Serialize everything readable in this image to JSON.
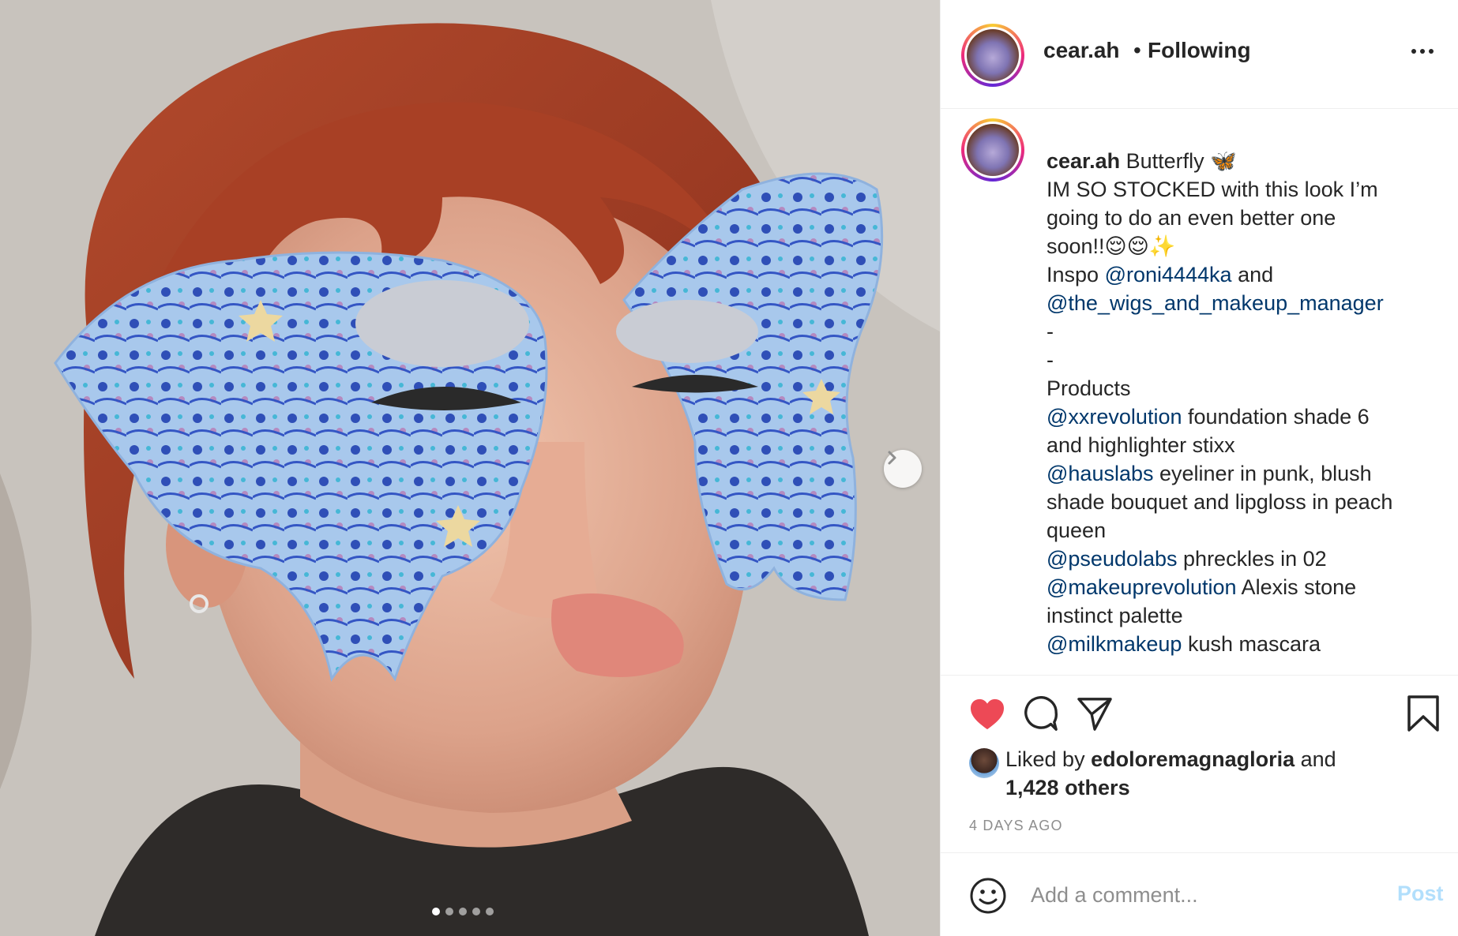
{
  "post": {
    "username": "cear.ah",
    "separator": "•",
    "follow_status": "Following",
    "photo_carousel": {
      "total_slides": 5,
      "active_slide": 1
    }
  },
  "caption": {
    "username": "cear.ah",
    "lines": [
      [
        {
          "t": "user",
          "v": "cear.ah"
        },
        {
          "t": "text",
          "v": " Butterfly 🦋"
        }
      ],
      [
        {
          "t": "text",
          "v": "IM SO STOCKED with this look I’m"
        }
      ],
      [
        {
          "t": "text",
          "v": "going to do an even better one"
        }
      ],
      [
        {
          "t": "text",
          "v": "soon!!😌😌✨"
        }
      ],
      [
        {
          "t": "text",
          "v": "Inspo "
        },
        {
          "t": "mention",
          "v": "@roni4444ka"
        },
        {
          "t": "text",
          "v": " and"
        }
      ],
      [
        {
          "t": "mention",
          "v": "@the_wigs_and_makeup_manager"
        }
      ],
      [
        {
          "t": "text",
          "v": "-"
        }
      ],
      [
        {
          "t": "text",
          "v": "-"
        }
      ],
      [
        {
          "t": "text",
          "v": "Products"
        }
      ],
      [
        {
          "t": "mention",
          "v": "@xxrevolution"
        },
        {
          "t": "text",
          "v": " foundation shade 6"
        }
      ],
      [
        {
          "t": "text",
          "v": "and highlighter stixx"
        }
      ],
      [
        {
          "t": "mention",
          "v": "@hauslabs"
        },
        {
          "t": "text",
          "v": " eyeliner in punk, blush"
        }
      ],
      [
        {
          "t": "text",
          "v": "shade bouquet and lipgloss in peach"
        }
      ],
      [
        {
          "t": "text",
          "v": "queen"
        }
      ],
      [
        {
          "t": "mention",
          "v": "@pseudolabs"
        },
        {
          "t": "text",
          "v": " phreckles in 02"
        }
      ],
      [
        {
          "t": "mention",
          "v": "@makeuprevolution"
        },
        {
          "t": "text",
          "v": " Alexis stone"
        }
      ],
      [
        {
          "t": "text",
          "v": "instinct palette"
        }
      ],
      [
        {
          "t": "mention",
          "v": "@milkmakeup"
        },
        {
          "t": "text",
          "v": " kush mascara"
        }
      ]
    ]
  },
  "actions": {
    "liked": true,
    "like_color": "#ed4956",
    "icons": [
      "heart-icon",
      "comment-icon",
      "share-icon",
      "bookmark-icon"
    ]
  },
  "likes": {
    "prefix": "Liked by ",
    "user": "edoloremagnagloria",
    "middle": " and",
    "others": "1,428 others"
  },
  "timestamp": "4 DAYS AGO",
  "comment": {
    "placeholder": "Add a comment...",
    "post_label": "Post",
    "post_color": "#b2dffc"
  },
  "colors": {
    "link": "#00376b",
    "muted": "#8e8e8e",
    "text": "#262626"
  }
}
